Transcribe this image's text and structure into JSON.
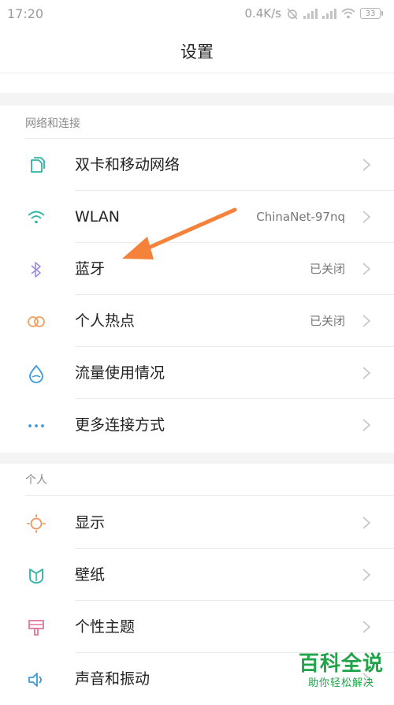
{
  "status": {
    "time": "17:20",
    "speed": "0.4K/s",
    "battery": "33"
  },
  "title": "设置",
  "sections": [
    {
      "header": "网络和连接",
      "items": [
        {
          "label": "双卡和移动网络",
          "value": ""
        },
        {
          "label": "WLAN",
          "value": "ChinaNet-97nq"
        },
        {
          "label": "蓝牙",
          "value": "已关闭"
        },
        {
          "label": "个人热点",
          "value": "已关闭"
        },
        {
          "label": "流量使用情况",
          "value": ""
        },
        {
          "label": "更多连接方式",
          "value": ""
        }
      ]
    },
    {
      "header": "个人",
      "items": [
        {
          "label": "显示",
          "value": ""
        },
        {
          "label": "壁纸",
          "value": ""
        },
        {
          "label": "个性主题",
          "value": ""
        },
        {
          "label": "声音和振动",
          "value": ""
        }
      ]
    }
  ],
  "icons": {
    "sim": "sim-card-icon",
    "wlan": "wifi-icon",
    "bt": "bluetooth-icon",
    "hotspot": "hotspot-icon",
    "data": "data-usage-icon",
    "more": "more-dots-icon",
    "display": "display-icon",
    "wallpaper": "wallpaper-icon",
    "theme": "theme-icon",
    "sound": "sound-icon"
  },
  "colors": {
    "accent_orange": "#f5823a",
    "watermark": "#21a34a"
  },
  "watermark": {
    "main": "百科全说",
    "sub": "助你轻松解决"
  }
}
